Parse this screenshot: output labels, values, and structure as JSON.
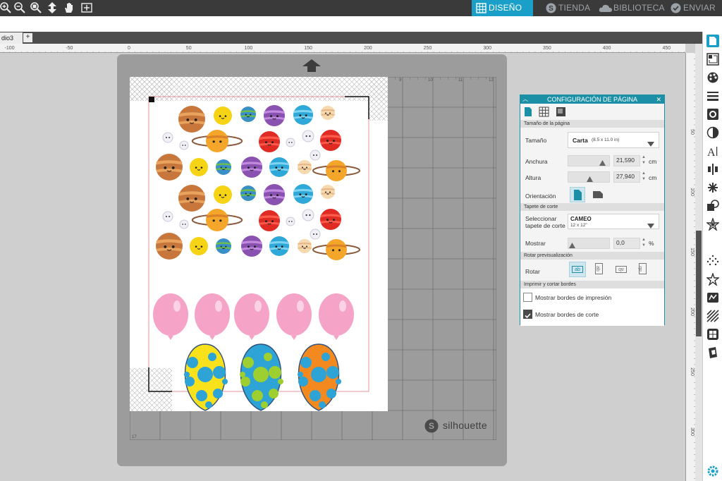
{
  "nav": {
    "tabs": [
      {
        "label": "DISEÑO",
        "icon": "grid-icon",
        "active": true
      },
      {
        "label": "TIENDA",
        "icon": "silhouette-s-icon",
        "active": false
      },
      {
        "label": "BIBLIOTECA",
        "icon": "cloud-icon",
        "active": false
      },
      {
        "label": "ENVIAR",
        "icon": "check-circle-icon",
        "active": false
      }
    ],
    "accent": "#1aa0c8"
  },
  "toolbar": {
    "tools": [
      "zoom-in-icon",
      "zoom-out-icon",
      "zoom-fit-icon",
      "move-arrows-icon",
      "hand-pan-icon",
      "add-box-icon"
    ]
  },
  "document": {
    "tab_label": "dio3",
    "add_label": "+"
  },
  "ruler": {
    "top_labels": [
      "-100",
      "-50",
      "0",
      "50",
      "100",
      "150",
      "200",
      "250",
      "300",
      "350",
      "400",
      "450"
    ],
    "side_labels": [
      "50",
      "100",
      "150",
      "200",
      "250",
      "300"
    ]
  },
  "mat": {
    "brand": "silhouette",
    "grid_numbers": [
      "9",
      "10",
      "11",
      "12"
    ],
    "corner_number": "17"
  },
  "page_setup": {
    "title": "CONFIGURACIÓN DE PÁGINA",
    "sections": {
      "page_size": "Tamaño de la página",
      "cutting_mat": "Tapete de corte",
      "rotate_preview": "Rotar previsualización",
      "print_cut": "Imprimir y cortar bordes"
    },
    "size_label": "Tamaño",
    "size_value": "Carta",
    "size_detail": "(8.5 x 11.0 in)",
    "width_label": "Anchura",
    "width_value": "21,590",
    "height_label": "Altura",
    "height_value": "27,940",
    "unit": "cm",
    "orientation_label": "Orientación",
    "mat_label": "Seleccionar tapete de corte",
    "mat_value": "CAMEO",
    "mat_detail": "12 x 12\"",
    "show_label": "Mostrar",
    "show_value": "0,0",
    "show_unit": "%",
    "rotate_label": "Rotar",
    "rotate_options": [
      "ab",
      "ab",
      "ab",
      "ab"
    ],
    "print_borders_label": "Mostrar bordes de impresión",
    "print_borders_checked": false,
    "cut_borders_label": "Mostrar bordes de corte",
    "cut_borders_checked": true
  },
  "right_panel_icons": [
    "page-setup-icon",
    "registration-icon",
    "fill-palette-icon",
    "line-style-icon",
    "image-trace-icon",
    "transparency-icon",
    "text-icon",
    "align-icon",
    "replicate-icon",
    "modify-icon",
    "offset-icon",
    "rhinestone-icon",
    "star-icon",
    "sketch-icon",
    "hatch-icon",
    "library-icon",
    "print-cut-icon",
    "settings-gear-icon"
  ]
}
